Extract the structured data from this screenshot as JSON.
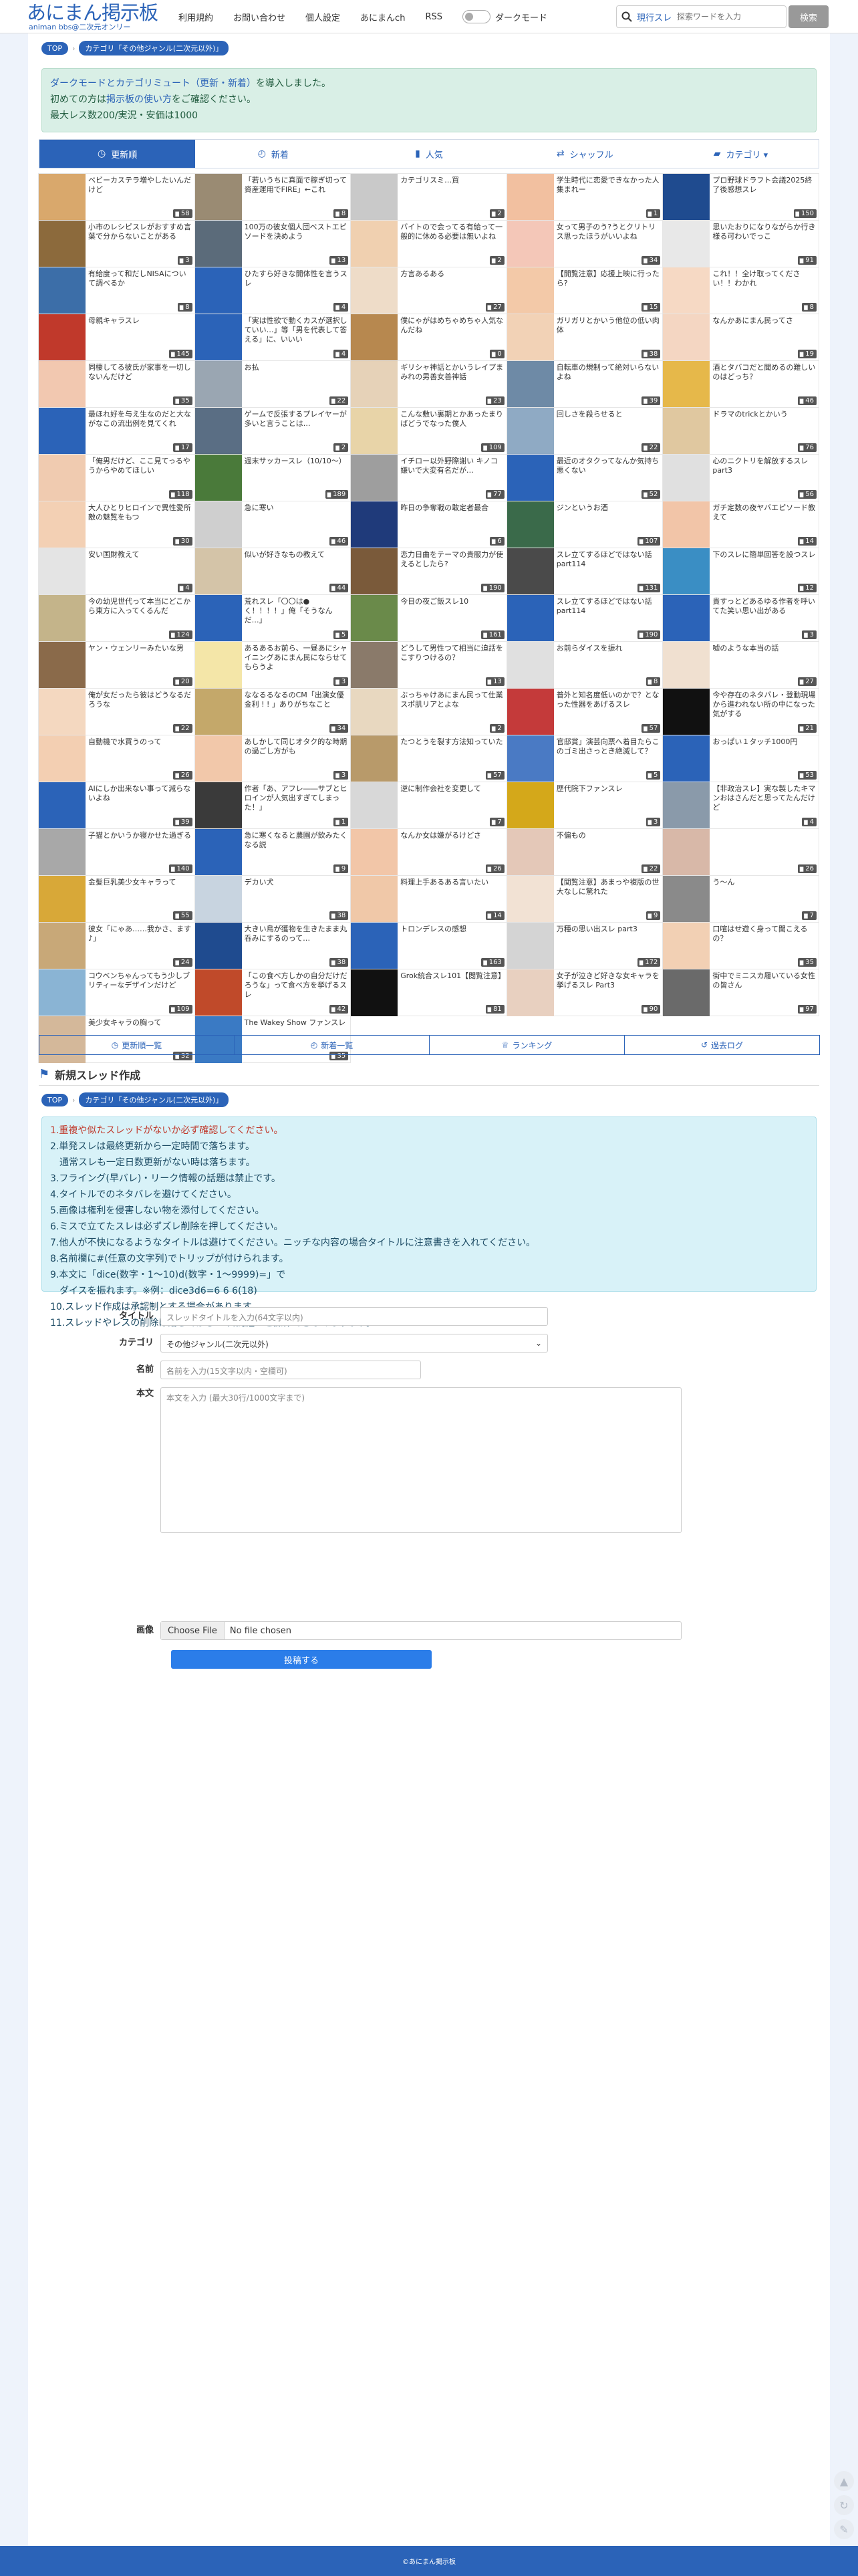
{
  "header": {
    "logo_main": "あにまん掲示板",
    "logo_sub": "animan bbs@二次元オンリー",
    "nav": [
      "利用規約",
      "お問い合わせ",
      "個人設定",
      "あにまんch",
      "RSS"
    ],
    "dark_label": "ダークモード",
    "search_mode": "現行スレ",
    "search_placeholder": "探索ワードを入力",
    "search_button": "検索"
  },
  "breadcrumb": {
    "top": "TOP",
    "category": "カテゴリ「その他ジャンル(二次元以外)」"
  },
  "notice": {
    "line1_link": "ダークモードとカテゴリミュート（更新・新着）",
    "line1_rest": "を導入しました。",
    "line2_pre": "初めての方は",
    "line2_link": "掲示板の使い方",
    "line2_rest": "をご確認ください。",
    "line3": "最大レス数200/実況・安価は1000"
  },
  "tabs": [
    {
      "label": "更新順",
      "icon": "◷"
    },
    {
      "label": "新着",
      "icon": "◴"
    },
    {
      "label": "人気",
      "icon": "▮"
    },
    {
      "label": "シャッフル",
      "icon": "⇄"
    },
    {
      "label": "カテゴリ ▾",
      "icon": "▰"
    }
  ],
  "threads": [
    {
      "title": "ベビーカステラ増やしたいんだけど",
      "count": "58",
      "color": "#d9a86c"
    },
    {
      "title": "「若いうちに真面で稼ぎ切って資産運用でFIRE」←これ",
      "count": "8",
      "color": "#9a8b73"
    },
    {
      "title": "カテゴリスミ…買",
      "count": "2",
      "color": "#c9c9c9"
    },
    {
      "title": "学生時代に恋愛できなかった人集まれー",
      "count": "1",
      "color": "#f2c0a0"
    },
    {
      "title": "プロ野球ドラフト会議2025終了後感想スレ",
      "count": "150",
      "color": "#1f4b8f"
    },
    {
      "title": "小市のレシピスレがおすすめ言葉で分からないことがある",
      "count": "3",
      "color": "#8c6a3c"
    },
    {
      "title": "100万の彼女個人団ベストエピソードを決めよう",
      "count": "13",
      "color": "#5b6b7a"
    },
    {
      "title": "バイトので会ってる有給って一般的に休める必要は無いよね",
      "count": "2",
      "color": "#f0d0b0"
    },
    {
      "title": "女って男子のう?うとクリトリス思ったほうがいいよね",
      "count": "34",
      "color": "#f4c7b8"
    },
    {
      "title": "思いたおりになりながらか行き様る可わいでっこ",
      "count": "91",
      "color": "#e8e8e8"
    },
    {
      "title": "有給度って和だしNISAについて調べるか",
      "count": "8",
      "color": "#3c6ea8"
    },
    {
      "title": "ひたすら好きな開体性を言うスレ",
      "count": "4",
      "color": "#2b63b8"
    },
    {
      "title": "方言あるある",
      "count": "27",
      "color": "#eedcc8"
    },
    {
      "title": "【開覧注意】応援上映に行ったら?",
      "count": "15",
      "color": "#f3c9a8"
    },
    {
      "title": "これ！！全け取ってください！！わかれ",
      "count": "8",
      "color": "#f6d9c4"
    },
    {
      "title": "母親キャラスレ",
      "count": "145",
      "color": "#c0392b"
    },
    {
      "title": "「実は性欲で動くカスが選択していい…」等「男を代表して答える」に、いいい",
      "count": "4",
      "color": "#2b63b8"
    },
    {
      "title": "僕にゃがはめちゃめちゃ人気なんだね",
      "count": "0",
      "color": "#b7884f"
    },
    {
      "title": "ガリガリとかいう他位の低い肉体",
      "count": "38",
      "color": "#f2d2b6"
    },
    {
      "title": "なんかあにまん民ってさ",
      "count": "19",
      "color": "#f4d6c2"
    },
    {
      "title": "同棲してる彼氏が家事を一切しないんだけど",
      "count": "35",
      "color": "#f2c8b0"
    },
    {
      "title": "お払",
      "count": "22",
      "color": "#9aa6b2"
    },
    {
      "title": "ギリシャ神話とかいうレイプまみれの男善女善神話",
      "count": "23",
      "color": "#e6d2b8"
    },
    {
      "title": "自転車の規制って絶対いらないよね",
      "count": "39",
      "color": "#6e8aa6"
    },
    {
      "title": "酒とタバコだと聞めるの難しいのはどっち？",
      "count": "46",
      "color": "#e6b84a"
    },
    {
      "title": "最ほれ好を与え生なのだと大ながなこの流出例を見てくれ",
      "count": "17",
      "color": "#2b63b8"
    },
    {
      "title": "ゲームで反張するプレイヤーが多いと言うことは…",
      "count": "2",
      "color": "#5a6e84"
    },
    {
      "title": "こんな敷い裏期とかあったまりばどうでなった僕人",
      "count": "109",
      "color": "#e8d4a8"
    },
    {
      "title": "回しさを殺らせると",
      "count": "22",
      "color": "#8faac4"
    },
    {
      "title": "ドラマのtrickとかいう",
      "count": "76",
      "color": "#e0c8a0"
    },
    {
      "title": "「俺男だけど、ここ見てっるやうからやめてほしい",
      "count": "118",
      "color": "#f0cbb0"
    },
    {
      "title": "週末サッカースレ（10/10〜）",
      "count": "189",
      "color": "#4a7a3a"
    },
    {
      "title": "イチロー以外野際謝い キノコ嫌いで大変有名だが…",
      "count": "77",
      "color": "#9e9e9e"
    },
    {
      "title": "最近のオタクってなんか気持ち悪くない",
      "count": "52",
      "color": "#2b63b8"
    },
    {
      "title": "心のニクトリを解放するスレpart3",
      "count": "56",
      "color": "#e0e0e0"
    },
    {
      "title": "大人ひとりヒロインで異性愛所敵の魅覧をもつ",
      "count": "30",
      "color": "#f3d0b4"
    },
    {
      "title": "急に寒い",
      "count": "46",
      "color": "#cfcfcf"
    },
    {
      "title": "昨日の争奪戦の敢定者最合",
      "count": "6",
      "color": "#1f3a7a"
    },
    {
      "title": "ジンというお酒",
      "count": "107",
      "color": "#3a6a4a"
    },
    {
      "title": "ガチ定数の夜ヤバエピソード教えて",
      "count": "14",
      "color": "#f2c5a8"
    },
    {
      "title": "安い国財教えて",
      "count": "4",
      "color": "#e4e4e4"
    },
    {
      "title": "似いが好きなもの教えて",
      "count": "44",
      "color": "#d4c4a8"
    },
    {
      "title": "恋力日曲をテーマの貴服力が使えるとしたら?",
      "count": "190",
      "color": "#7a5a3a"
    },
    {
      "title": "スレ立てするほどではない話part114",
      "count": "131",
      "color": "#4a4a4a"
    },
    {
      "title": "下のスレに簡単回答を設つスレ",
      "count": "12",
      "color": "#3a8ec4"
    },
    {
      "title": "今の幼児世代って本当にどこから東方に入ってくるんだ",
      "count": "124",
      "color": "#c4b48a"
    },
    {
      "title": "荒れスレ「〇〇は●く！！！！」俺「そうなん だ…」",
      "count": "5",
      "color": "#2b63b8"
    },
    {
      "title": "今日の夜ご飯スレ10",
      "count": "161",
      "color": "#6a8a4a"
    },
    {
      "title": "スレ立てするほどではない話part114",
      "count": "190",
      "color": "#2b63b8"
    },
    {
      "title": "貴すっとどあるゆる作者を呼いてた笑い思い出がある",
      "count": "3",
      "color": "#2b63b8"
    },
    {
      "title": "ヤン・ウェンリーみたいな男",
      "count": "20",
      "color": "#8a6a4a"
    },
    {
      "title": "あるあるお前ら、一昼あにシャイニングあにまん民にならせてもらうよ",
      "count": "3",
      "color": "#f4e6a8"
    },
    {
      "title": "どうして男性つて相当に迫話をこすりつけるの？",
      "count": "13",
      "color": "#8a7a6a"
    },
    {
      "title": "お前らダイスを振れ",
      "count": "8",
      "color": "#e0e0e0"
    },
    {
      "title": "嘘のような本当の話",
      "count": "27",
      "color": "#f0e0d0"
    },
    {
      "title": "俺が女だったら彼はどうなるだろうな",
      "count": "22",
      "color": "#f4d8c0"
    },
    {
      "title": "ななるるなるのCM「出演女優金利 ! ! 」ありがちなこと",
      "count": "34",
      "color": "#c4a86a"
    },
    {
      "title": "ぶっちゃけあにまん民って仕業スポ肌リアとよな",
      "count": "2",
      "color": "#e8d8c0"
    },
    {
      "title": "普外と知名度低いのかで？となった性器をあげるスレ",
      "count": "57",
      "color": "#c43a3a"
    },
    {
      "title": "今や存在のネタバレ・登動現場から進われない所の中になった気がする",
      "count": "21",
      "color": "#111111"
    },
    {
      "title": "自動機で水買うのって",
      "count": "26",
      "color": "#f3cfb2"
    },
    {
      "title": "あしかして同じオタク的な時期の過ごし方がも",
      "count": "3",
      "color": "#f2c8aa"
    },
    {
      "title": "たつとうを裂す方法知っていた",
      "count": "57",
      "color": "#b89a6a"
    },
    {
      "title": "官邸賞」演芸向票へ着目たらこのゴミ出さっとき絶滅して？",
      "count": "5",
      "color": "#4a7ac4"
    },
    {
      "title": "おっぱい１タッチ1000円",
      "count": "53",
      "color": "#2b63b8"
    },
    {
      "title": "AIにしか出来ない事って減らないよね",
      "count": "39",
      "color": "#2b63b8"
    },
    {
      "title": "作者「あ、アフレ――サブとヒロインが人気出すぎてしまった！」",
      "count": "1",
      "color": "#3a3a3a"
    },
    {
      "title": "逆に制作会社を変更して",
      "count": "7",
      "color": "#d8d8d8"
    },
    {
      "title": "歴代院下ファンスレ",
      "count": "3",
      "color": "#d4a81a"
    },
    {
      "title": "【非政治スレ】実な製したキマンおはさんだと思ってたんだけど",
      "count": "4",
      "color": "#8a9aaa"
    },
    {
      "title": "子猫とかいうか寝かせた過ぎる",
      "count": "140",
      "color": "#a8a8a8"
    },
    {
      "title": "急に寒くなると農園が飲みたくなる説",
      "count": "9",
      "color": "#2b63b8"
    },
    {
      "title": "なんか女は嫌がるけどさ",
      "count": "26",
      "color": "#f2c6a8"
    },
    {
      "title": "不偏もの",
      "count": "22",
      "color": "#e4c8b8"
    },
    {
      "title": "",
      "count": "26",
      "color": "#d8b8a8"
    },
    {
      "title": "金髪巨乳美少女キャラって",
      "count": "55",
      "color": "#d8a838"
    },
    {
      "title": "デカい犬",
      "count": "38",
      "color": "#c8d4e0"
    },
    {
      "title": "料理上手あるある言いたい",
      "count": "14",
      "color": "#f0c8a8"
    },
    {
      "title": "【閲覧注意】あまっや複版の世大なしに驚れた",
      "count": "9",
      "color": "#f2e2d4"
    },
    {
      "title": "う〜ん",
      "count": "7",
      "color": "#8a8a8a"
    },
    {
      "title": "彼女「にゃあ……我かさ、ます♪」",
      "count": "24",
      "color": "#c8a878"
    },
    {
      "title": "大きい鳥が獲物を生きたまま丸呑みにするのって…",
      "count": "38",
      "color": "#1f4b8f"
    },
    {
      "title": "トロンデレスの感想",
      "count": "163",
      "color": "#2b63b8"
    },
    {
      "title": "万種の思い出スレ part3",
      "count": "172",
      "color": "#d4d4d4"
    },
    {
      "title": "口喧はせ遊く身って聞こえるの？",
      "count": "35",
      "color": "#f2d0b4"
    },
    {
      "title": "コウベンちゃんってもう少しブリティーなデザインだけど",
      "count": "109",
      "color": "#8ab4d4"
    },
    {
      "title": "「この食べ方しかの自分だけだろうな」って食べ方を挙げるスレ",
      "count": "42",
      "color": "#c04a2a"
    },
    {
      "title": "Grok統合スレ101【閲覧注意】",
      "count": "81",
      "color": "#111111"
    },
    {
      "title": "女子が泣きど好きな女キャラを挙げるスレ Part3",
      "count": "90",
      "color": "#e8d0c0"
    },
    {
      "title": "街中でミニスカ履いている女性の皆さん",
      "count": "97",
      "color": "#6a6a6a"
    },
    {
      "title": "美少女キャラの胸って",
      "count": "32",
      "color": "#d4b89a"
    },
    {
      "title": "The Wakey Show ファンスレ",
      "count": "35",
      "color": "#3a7ac4"
    }
  ],
  "foot_tabs": [
    {
      "label": "更新順一覧",
      "icon": "◷"
    },
    {
      "label": "新着一覧",
      "icon": "◴"
    },
    {
      "label": "ランキング",
      "icon": "♕"
    },
    {
      "label": "過去ログ",
      "icon": "↺"
    }
  ],
  "new_thread": {
    "title": "新規スレッド作成",
    "rules": [
      "1.重複や似たスレッドがないか必ず確認してください。",
      "2.単発スレは最終更新から一定時間で落ちます。",
      "　通常スレも一定日数更新がない時は落ちます。",
      "3.フライング(早バレ)・リーク情報の話題は禁止です。",
      "4.タイトルでのネタバレを避けてください。",
      "5.画像は権利を侵害しない物を添付してください。",
      "6.ミスで立てたスレは必ずズレ削除を押してください。",
      "7.他人が不快になるようなタイトルは避けてください。ニッチな内容の場合タイトルに注意書きを入れてください。",
      "8.名前欄に#(任意の文字列)でトリップが付けられます。",
      "9.本文に「dice(数字・1〜10)d(数字・1〜9999)=」で",
      "　ダイスを振れます。※例：dice3d6=6 6 6(18)",
      "10.スレッド作成は承認制とする場合があります。",
      "11.スレッドやレスの削除は落ちてから10日間経つと操作できなくなります。"
    ],
    "label_title": "タイトル",
    "placeholder_title": "スレッドタイトルを入力(64文字以内)",
    "label_category": "カテゴリ",
    "category_value": "その他ジャンル(二次元以外)",
    "label_name": "名前",
    "placeholder_name": "名前を入力(15文字以内・空欄可)",
    "label_body": "本文",
    "placeholder_body": "本文を入力 (最大30行/1000文字まで)",
    "label_image": "画像",
    "file_button": "Choose File",
    "file_status": "No file chosen",
    "submit": "投稿する"
  },
  "footer": "©あにまん掲示板",
  "colors": {
    "accent": "#2b63b8",
    "notice_bg": "#d9efe6",
    "rules_bg": "#d8f2f8"
  }
}
